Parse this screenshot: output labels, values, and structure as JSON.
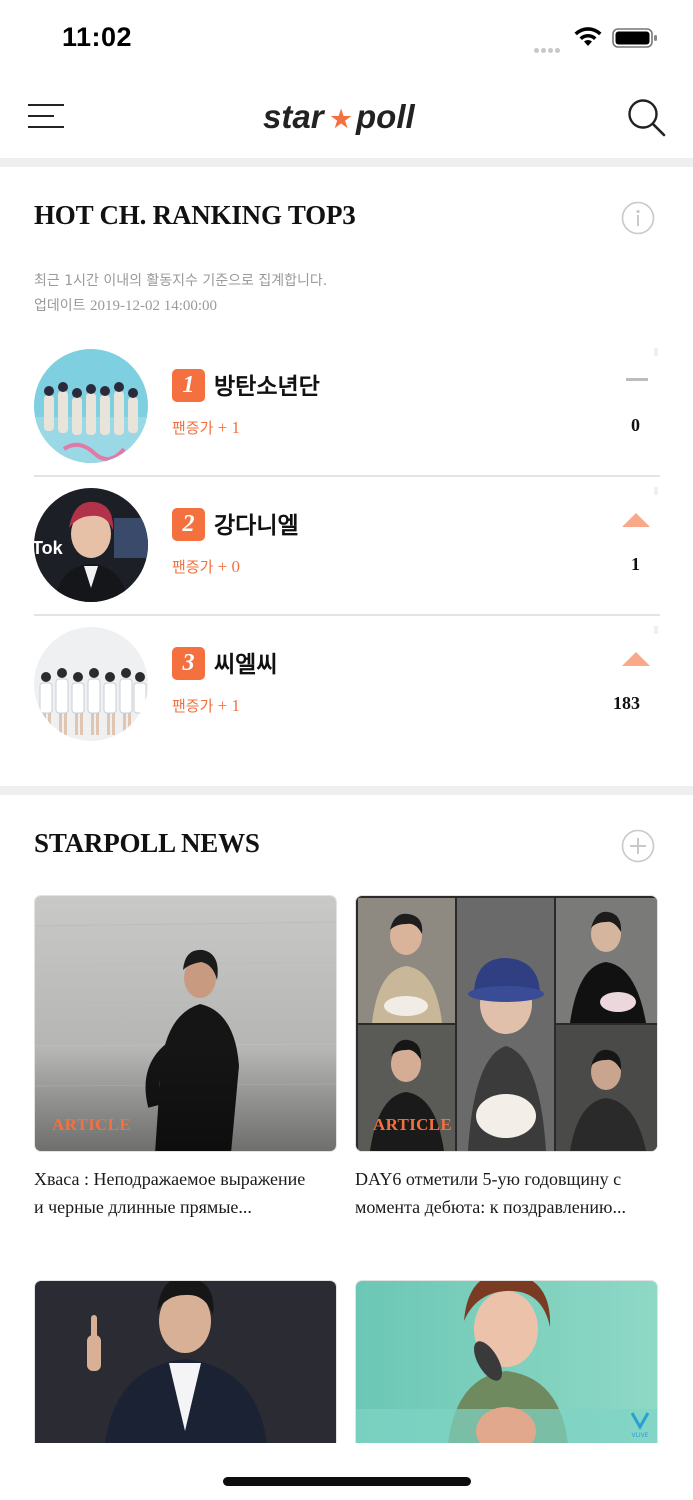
{
  "status_bar": {
    "time": "11:02"
  },
  "header": {
    "logo_left": "star",
    "logo_right": "poll",
    "logo_star": "★"
  },
  "ranking": {
    "title": "HOT CH. RANKING TOP3",
    "description": "최근 1시간 이내의 활동지수 기준으로 집계합니다.",
    "update_label": "업데이트",
    "update_time": "2019-12-02 14:00:00",
    "items": [
      {
        "rank": "1",
        "name": "방탄소년단",
        "fan_label": "팬증가",
        "fan_value": "+ 1",
        "change": "0",
        "trend": "same"
      },
      {
        "rank": "2",
        "name": "강다니엘",
        "fan_label": "팬증가",
        "fan_value": "+ 0",
        "change": "1",
        "trend": "up"
      },
      {
        "rank": "3",
        "name": "씨엘씨",
        "fan_label": "팬증가",
        "fan_value": "+ 1",
        "change": "183",
        "trend": "up"
      }
    ]
  },
  "news": {
    "title": "STARPOLL NEWS",
    "items": [
      {
        "label": "ARTICLE",
        "headline_line1": "Хваса : Неподражаемое выражение",
        "headline_line2": "и черные длинные прямые..."
      },
      {
        "label": "ARTICLE",
        "headline_line1": "DAY6 отметили 5-ую годовщину с",
        "headline_line2": "момента дебюта: к поздравлению..."
      }
    ],
    "vlive_badge": "VLIVE"
  },
  "colors": {
    "accent": "#f4703f",
    "trend_up": "#f9a98a",
    "divider": "#efefef"
  },
  "icons": [
    "wifi-icon",
    "battery-icon",
    "menu-icon",
    "search-icon",
    "info-icon",
    "plus-icon",
    "minus-icon",
    "triangle-up-icon",
    "vlive-icon"
  ]
}
